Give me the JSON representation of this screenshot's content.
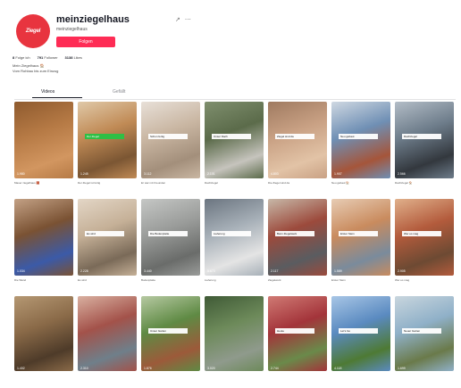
{
  "profile": {
    "avatar_text": "Ziegel",
    "handle": "meinziegelhaus",
    "nickname": "meinziegelhaus",
    "follow_label": "Folgen",
    "stats": [
      {
        "value": "8",
        "label": "Folge ich"
      },
      {
        "value": "791",
        "label": "Follower"
      },
      {
        "value": "3138",
        "label": "Likes"
      }
    ],
    "bio_lines": [
      "Mein Ziegelhaus 🏠",
      "Vom Rohbau bis zum Einzug"
    ]
  },
  "tabs": [
    {
      "label": "Videos",
      "active": true
    },
    {
      "label": "Gefällt",
      "active": false
    }
  ],
  "videos": [
    {
      "caption": "",
      "caption_style": "none",
      "views": "1.980",
      "desc": "Mauer ziegelhaus 🧱",
      "palette": [
        "#b67a45",
        "#d29660",
        "#8e5a2e"
      ]
    },
    {
      "caption": "Der Ziegel",
      "caption_style": "green",
      "views": "1.245",
      "desc": "Der Ziegel ist fertig",
      "palette": [
        "#c08a55",
        "#7b5633",
        "#e0c9a8"
      ]
    },
    {
      "caption": "Schon fertig",
      "caption_style": "white",
      "views": "3.112",
      "desc": "Er war mit Freunden",
      "palette": [
        "#c9b6a2",
        "#a38f7b",
        "#e8e0d8"
      ]
    },
    {
      "caption": "Unser Dach",
      "caption_style": "white",
      "views": "2.101",
      "desc": "Dachziegel",
      "palette": [
        "#5b6b4a",
        "#c6c4bd",
        "#7f8f6e"
      ]
    },
    {
      "caption": "Ziegel sind da",
      "caption_style": "white",
      "views": "4.803",
      "desc": "Die Ziegel sind da",
      "palette": [
        "#c9a184",
        "#e2c3a6",
        "#9f7a60"
      ]
    },
    {
      "caption": "Neu gebaut",
      "caption_style": "white",
      "views": "1.907",
      "desc": "Neu gebaut 🏠",
      "palette": [
        "#6f8fb4",
        "#a5553a",
        "#cfd8e2"
      ]
    },
    {
      "caption": "Dachziegel",
      "caption_style": "white",
      "views": "2.566",
      "desc": "Dachziegel 🏠",
      "palette": [
        "#6d7c8a",
        "#33383e",
        "#b3bdc7"
      ]
    },
    {
      "caption": "",
      "caption_style": "none",
      "views": "1.034",
      "desc": "Die Wand",
      "palette": [
        "#7a5233",
        "#3b5aa8",
        "#c3a185"
      ]
    },
    {
      "caption": "Es wird",
      "caption_style": "white",
      "views": "2.228",
      "desc": "Es wird",
      "palette": [
        "#c5b097",
        "#7a6a58",
        "#e3d6c6"
      ]
    },
    {
      "caption": "Die Bodenplatte",
      "caption_style": "white",
      "views": "3.440",
      "desc": "Bodenplatte",
      "palette": [
        "#9a9c9a",
        "#6a6c6a",
        "#c5c7c5"
      ]
    },
    {
      "caption": "Lieferung",
      "caption_style": "white",
      "views": "5.673",
      "desc": "Lieferung",
      "palette": [
        "#a7b0b8",
        "#e4e4e4",
        "#6b7580"
      ]
    },
    {
      "caption": "Beim Ziegelwerk",
      "caption_style": "white",
      "views": "2.117",
      "desc": "Ziegelwerk",
      "palette": [
        "#9c4a3c",
        "#5a5c60",
        "#c7b8a8"
      ]
    },
    {
      "caption": "Erster Stein",
      "caption_style": "white",
      "views": "1.589",
      "desc": "Erster Stein",
      "palette": [
        "#c98b5e",
        "#7a8b9c",
        "#e7ccb4"
      ]
    },
    {
      "caption": "Wer es mag",
      "caption_style": "white",
      "views": "2.905",
      "desc": "Wer es mag",
      "palette": [
        "#b35b3c",
        "#6d4a33",
        "#e0b08b"
      ]
    },
    {
      "caption": "",
      "caption_style": "none",
      "views": "1.402",
      "desc": "",
      "palette": [
        "#8a6a48",
        "#4e3b29",
        "#b59873"
      ]
    },
    {
      "caption": "",
      "caption_style": "none",
      "views": "2.310",
      "desc": "",
      "palette": [
        "#a3524a",
        "#6f7f8a",
        "#d9b0a0"
      ]
    },
    {
      "caption": "Unser Garten",
      "caption_style": "white",
      "views": "1.876",
      "desc": "",
      "palette": [
        "#5f8a44",
        "#9c5a3a",
        "#b6c9a2"
      ]
    },
    {
      "caption": "",
      "caption_style": "none",
      "views": "3.020",
      "desc": "",
      "palette": [
        "#6d8a5a",
        "#8f9a8c",
        "#3f5a36"
      ]
    },
    {
      "caption": "Heute",
      "caption_style": "white",
      "views": "2.744",
      "desc": "",
      "palette": [
        "#a3343a",
        "#6a8a4a",
        "#d07a74"
      ]
    },
    {
      "caption": "Let's Go",
      "caption_style": "white",
      "views": "4.118",
      "desc": "",
      "palette": [
        "#5a8ac0",
        "#4e7a34",
        "#a8c6e6"
      ]
    },
    {
      "caption": "Neuer Garten",
      "caption_style": "white",
      "views": "1.699",
      "desc": "",
      "palette": [
        "#8fb0c8",
        "#6a7a4a",
        "#c9d6de"
      ]
    }
  ]
}
